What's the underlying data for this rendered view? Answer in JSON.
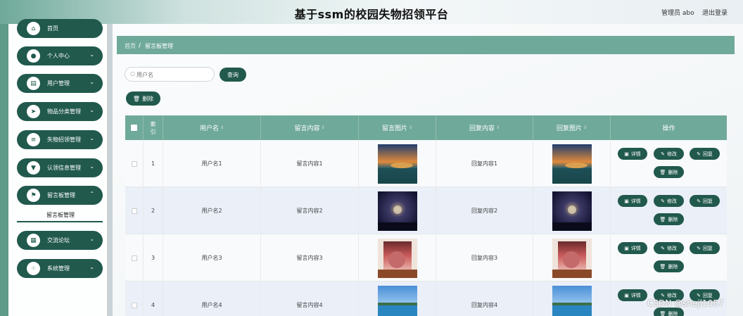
{
  "header": {
    "title": "基于ssm的校园失物招领平台",
    "user": "管理员 abo",
    "logout": "退出登录"
  },
  "sidebar": {
    "items": [
      {
        "label": "首页",
        "icon": "home-icon",
        "glyph": "⌂"
      },
      {
        "label": "个人中心",
        "icon": "person-icon",
        "glyph": "●"
      },
      {
        "label": "用户管理",
        "icon": "clipboard-icon",
        "glyph": "▤"
      },
      {
        "label": "物品分类管理",
        "icon": "send-icon",
        "glyph": "➤"
      },
      {
        "label": "失物招领管理",
        "icon": "sliders-icon",
        "glyph": "≡"
      },
      {
        "label": "认领信息管理",
        "icon": "funnel-icon",
        "glyph": "▼"
      },
      {
        "label": "留言板管理",
        "icon": "flag-icon",
        "glyph": "⚑"
      },
      {
        "label": "交流论坛",
        "icon": "grid-icon",
        "glyph": "▦"
      },
      {
        "label": "系统管理",
        "icon": "apps-icon",
        "glyph": "⁘"
      }
    ],
    "submenu_label": "留言板管理"
  },
  "breadcrumb": {
    "home": "首页",
    "separator": "/",
    "current": "留言板管理"
  },
  "search": {
    "placeholder": "用户名",
    "button": "查询"
  },
  "toolbar": {
    "delete": "删除"
  },
  "table": {
    "columns": [
      "索引",
      "用户名",
      "留言内容",
      "留言图片",
      "回复内容",
      "回复图片",
      "操作"
    ],
    "rows": [
      {
        "index": "1",
        "username": "用户名1",
        "message": "留言内容1",
        "reply": "回复内容1",
        "img": "lake"
      },
      {
        "index": "2",
        "username": "用户名2",
        "message": "留言内容2",
        "reply": "回复内容2",
        "img": "galaxy"
      },
      {
        "index": "3",
        "username": "用户名3",
        "message": "留言内容3",
        "reply": "回复内容3",
        "img": "girl"
      },
      {
        "index": "4",
        "username": "用户名4",
        "message": "留言内容4",
        "reply": "回复内容4",
        "img": "sea"
      }
    ],
    "actions": {
      "detail": "详情",
      "edit": "修改",
      "reply": "回复",
      "delete": "删除"
    }
  },
  "watermark": "CSDN @shejl1057",
  "colors": {
    "primary": "#21594d",
    "header_bg": "#6fa99a"
  }
}
